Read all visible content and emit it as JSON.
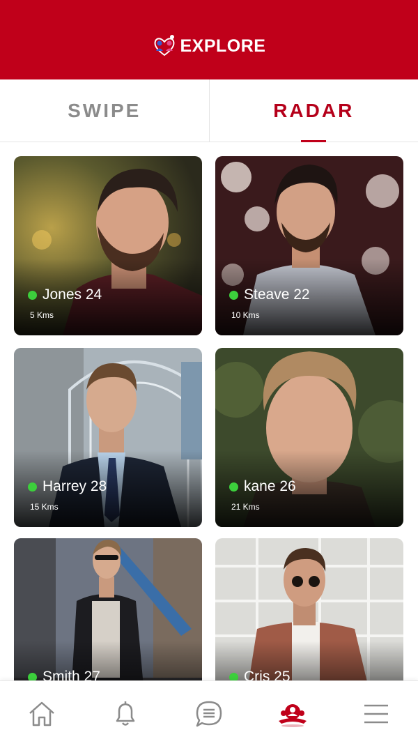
{
  "header": {
    "title": "EXPLORE",
    "logo_icon": "couple-heart-logo-icon"
  },
  "tabs": [
    {
      "label": "SWIPE",
      "active": false
    },
    {
      "label": "RADAR",
      "active": true
    }
  ],
  "profiles": [
    {
      "name": "Jones 24",
      "distance": "5 Kms",
      "online": true
    },
    {
      "name": "Steave 22",
      "distance": "10 Kms",
      "online": true
    },
    {
      "name": "Harrey 28",
      "distance": "15 Kms",
      "online": true
    },
    {
      "name": "kane 26",
      "distance": "21 Kms",
      "online": true
    },
    {
      "name": "Smith 27",
      "distance": "",
      "online": true
    },
    {
      "name": "Cris 25",
      "distance": "",
      "online": true
    }
  ],
  "nav": [
    {
      "icon": "home-icon",
      "active": false
    },
    {
      "icon": "bell-icon",
      "active": false
    },
    {
      "icon": "chat-icon",
      "active": false
    },
    {
      "icon": "radar-people-icon",
      "active": true
    },
    {
      "icon": "menu-icon",
      "active": false
    }
  ],
  "colors": {
    "brand": "#c0001a",
    "online": "#3ccf3c",
    "inactive": "#8b8b8b"
  }
}
